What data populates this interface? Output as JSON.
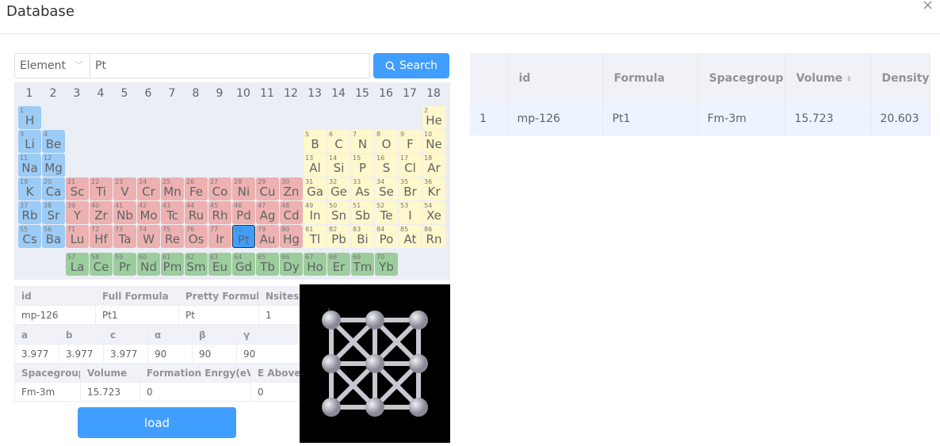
{
  "dialog": {
    "title": "Database",
    "close_icon": "close-icon"
  },
  "search": {
    "field_select": "Element",
    "query": "Pt",
    "button_label": "Search"
  },
  "colors": {
    "alkali": "#9ccbf5",
    "transition": "#ecb1b0",
    "pblock": "#fff8cc",
    "lanthanide": "#9ccd9c",
    "selected": "#409eff",
    "accent": "#409eff"
  },
  "periodic_table": {
    "groups": [
      "1",
      "2",
      "3",
      "4",
      "5",
      "6",
      "7",
      "8",
      "9",
      "10",
      "11",
      "12",
      "13",
      "14",
      "15",
      "16",
      "17",
      "18"
    ],
    "selected": "Pt",
    "periods": [
      [
        [
          1,
          "H",
          1
        ],
        [
          2,
          "He",
          18
        ]
      ],
      [
        [
          3,
          "Li",
          1
        ],
        [
          4,
          "Be",
          2
        ],
        [
          5,
          "B",
          13
        ],
        [
          6,
          "C",
          14
        ],
        [
          7,
          "N",
          15
        ],
        [
          8,
          "O",
          16
        ],
        [
          9,
          "F",
          17
        ],
        [
          10,
          "Ne",
          18
        ]
      ],
      [
        [
          11,
          "Na",
          1
        ],
        [
          12,
          "Mg",
          2
        ],
        [
          13,
          "Al",
          13
        ],
        [
          14,
          "Si",
          14
        ],
        [
          15,
          "P",
          15
        ],
        [
          16,
          "S",
          16
        ],
        [
          17,
          "Cl",
          17
        ],
        [
          18,
          "Ar",
          18
        ]
      ],
      [
        [
          19,
          "K",
          1
        ],
        [
          20,
          "Ca",
          2
        ],
        [
          21,
          "Sc",
          3
        ],
        [
          22,
          "Ti",
          4
        ],
        [
          23,
          "V",
          5
        ],
        [
          24,
          "Cr",
          6
        ],
        [
          25,
          "Mn",
          7
        ],
        [
          26,
          "Fe",
          8
        ],
        [
          27,
          "Co",
          9
        ],
        [
          28,
          "Ni",
          10
        ],
        [
          29,
          "Cu",
          11
        ],
        [
          30,
          "Zn",
          12
        ],
        [
          31,
          "Ga",
          13
        ],
        [
          32,
          "Ge",
          14
        ],
        [
          33,
          "As",
          15
        ],
        [
          34,
          "Se",
          16
        ],
        [
          35,
          "Br",
          17
        ],
        [
          36,
          "Kr",
          18
        ]
      ],
      [
        [
          37,
          "Rb",
          1
        ],
        [
          38,
          "Sr",
          2
        ],
        [
          39,
          "Y",
          3
        ],
        [
          40,
          "Zr",
          4
        ],
        [
          41,
          "Nb",
          5
        ],
        [
          42,
          "Mo",
          6
        ],
        [
          43,
          "Tc",
          7
        ],
        [
          44,
          "Ru",
          8
        ],
        [
          45,
          "Rh",
          9
        ],
        [
          46,
          "Pd",
          10
        ],
        [
          47,
          "Ag",
          11
        ],
        [
          48,
          "Cd",
          12
        ],
        [
          49,
          "In",
          13
        ],
        [
          50,
          "Sn",
          14
        ],
        [
          51,
          "Sb",
          15
        ],
        [
          52,
          "Te",
          16
        ],
        [
          53,
          "I",
          17
        ],
        [
          54,
          "Xe",
          18
        ]
      ],
      [
        [
          55,
          "Cs",
          1
        ],
        [
          56,
          "Ba",
          2
        ],
        [
          71,
          "Lu",
          3
        ],
        [
          72,
          "Hf",
          4
        ],
        [
          73,
          "Ta",
          5
        ],
        [
          74,
          "W",
          6
        ],
        [
          75,
          "Re",
          7
        ],
        [
          76,
          "Os",
          8
        ],
        [
          77,
          "Ir",
          9
        ],
        [
          78,
          "Pt",
          10
        ],
        [
          79,
          "Au",
          11
        ],
        [
          80,
          "Hg",
          12
        ],
        [
          81,
          "Tl",
          13
        ],
        [
          82,
          "Pb",
          14
        ],
        [
          83,
          "Bi",
          15
        ],
        [
          84,
          "Po",
          16
        ],
        [
          85,
          "At",
          17
        ],
        [
          86,
          "Rn",
          18
        ]
      ]
    ],
    "lanthanides": [
      [
        57,
        "La"
      ],
      [
        58,
        "Ce"
      ],
      [
        59,
        "Pr"
      ],
      [
        60,
        "Nd"
      ],
      [
        61,
        "Pm"
      ],
      [
        62,
        "Sm"
      ],
      [
        63,
        "Eu"
      ],
      [
        64,
        "Gd"
      ],
      [
        65,
        "Tb"
      ],
      [
        66,
        "Dy"
      ],
      [
        67,
        "Ho"
      ],
      [
        68,
        "Er"
      ],
      [
        69,
        "Tm"
      ],
      [
        70,
        "Yb"
      ]
    ]
  },
  "details": {
    "t1": {
      "headers": [
        "id",
        "Full Formula",
        "Pretty Formula",
        "Nsites"
      ],
      "values": [
        "mp-126",
        "Pt1",
        "Pt",
        "1"
      ]
    },
    "t2": {
      "headers": [
        "a",
        "b",
        "c",
        "α",
        "β",
        "γ"
      ],
      "values": [
        "3.977",
        "3.977",
        "3.977",
        "90",
        "90",
        "90"
      ]
    },
    "t3": {
      "headers": [
        "Spacegroup",
        "Volume",
        "Formation Enrgy(eV)",
        "E Above Hull"
      ],
      "values": [
        "Fm-3m",
        "15.723",
        "0",
        "0"
      ]
    },
    "load_label": "load"
  },
  "results": {
    "columns": [
      "",
      "id",
      "Formula",
      "Spacegroup",
      "Volume",
      "Density"
    ],
    "sortable": [
      "Volume",
      "Density"
    ],
    "rows": [
      [
        "1",
        "mp-126",
        "Pt1",
        "Fm-3m",
        "15.723",
        "20.603"
      ]
    ]
  }
}
